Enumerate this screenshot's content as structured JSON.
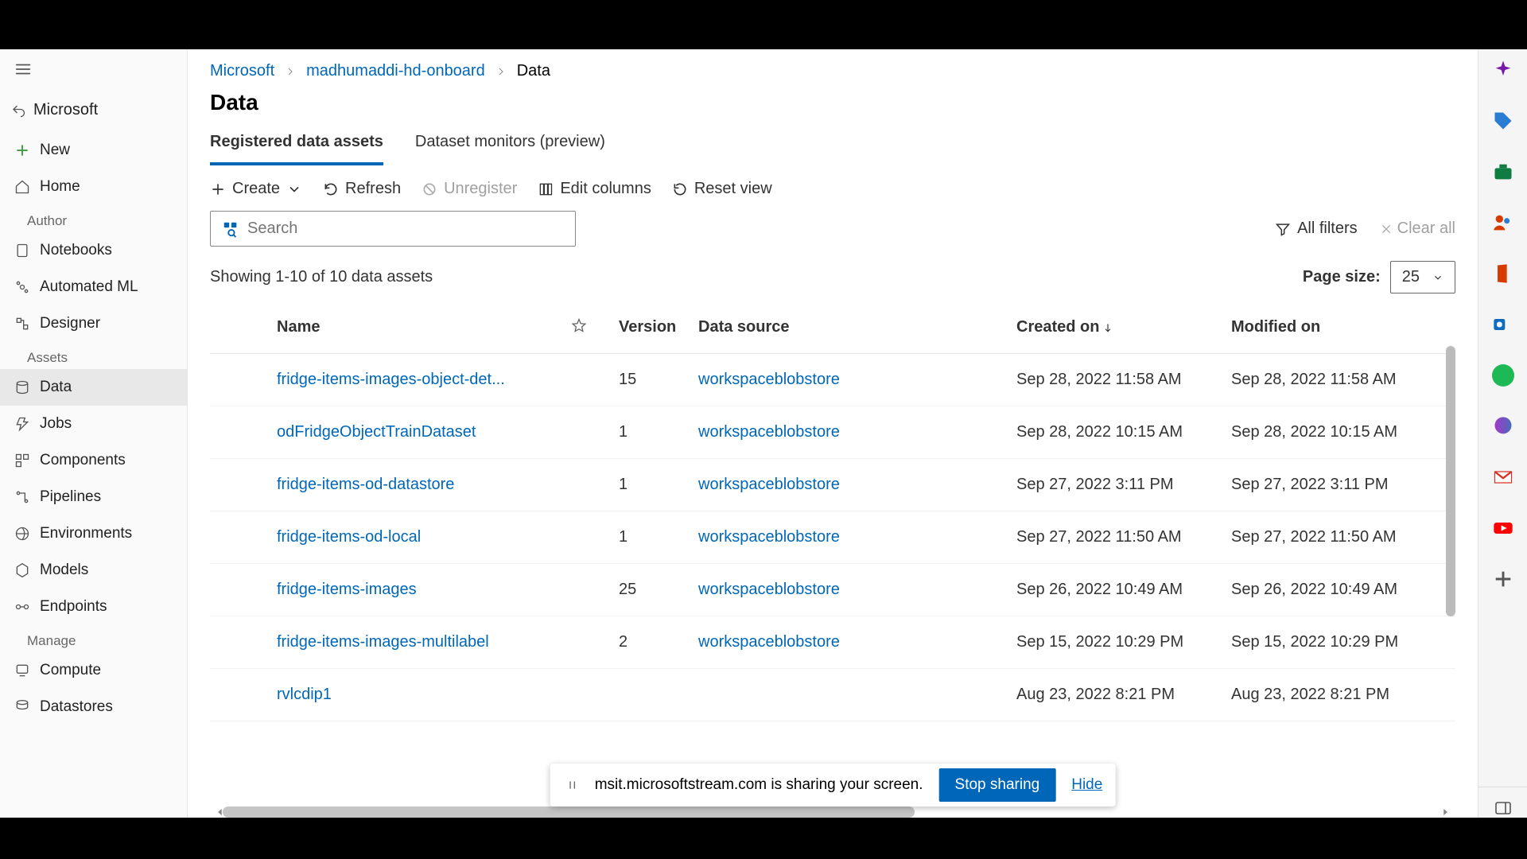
{
  "app_back": "Microsoft",
  "sidebar": {
    "new": "New",
    "home": "Home",
    "section_author": "Author",
    "author": [
      "Notebooks",
      "Automated ML",
      "Designer"
    ],
    "section_assets": "Assets",
    "assets": [
      "Data",
      "Jobs",
      "Components",
      "Pipelines",
      "Environments",
      "Models",
      "Endpoints"
    ],
    "section_manage": "Manage",
    "manage": [
      "Compute",
      "Datastores"
    ]
  },
  "breadcrumb": [
    "Microsoft",
    "madhumaddi-hd-onboard",
    "Data"
  ],
  "page_title": "Data",
  "tabs": [
    "Registered data assets",
    "Dataset monitors (preview)"
  ],
  "toolbar": {
    "create": "Create",
    "refresh": "Refresh",
    "unregister": "Unregister",
    "edit": "Edit columns",
    "reset": "Reset view"
  },
  "search_placeholder": "Search",
  "filters": {
    "all": "All filters",
    "clear": "Clear all"
  },
  "result_count": "Showing 1-10 of 10 data assets",
  "page_size_label": "Page size:",
  "page_size_value": "25",
  "columns": [
    "",
    "Name",
    "",
    "Version",
    "Data source",
    "Created on",
    "Modified on"
  ],
  "rows": [
    {
      "name": "fridge-items-images-object-det...",
      "version": "15",
      "ds": "workspaceblobstore",
      "created": "Sep 28, 2022 11:58 AM",
      "modified": "Sep 28, 2022 11:58 AM"
    },
    {
      "name": "odFridgeObjectTrainDataset",
      "version": "1",
      "ds": "workspaceblobstore",
      "created": "Sep 28, 2022 10:15 AM",
      "modified": "Sep 28, 2022 10:15 AM"
    },
    {
      "name": "fridge-items-od-datastore",
      "version": "1",
      "ds": "workspaceblobstore",
      "created": "Sep 27, 2022 3:11 PM",
      "modified": "Sep 27, 2022 3:11 PM"
    },
    {
      "name": "fridge-items-od-local",
      "version": "1",
      "ds": "workspaceblobstore",
      "created": "Sep 27, 2022 11:50 AM",
      "modified": "Sep 27, 2022 11:50 AM"
    },
    {
      "name": "fridge-items-images",
      "version": "25",
      "ds": "workspaceblobstore",
      "created": "Sep 26, 2022 10:49 AM",
      "modified": "Sep 26, 2022 10:49 AM"
    },
    {
      "name": "fridge-items-images-multilabel",
      "version": "2",
      "ds": "workspaceblobstore",
      "created": "Sep 15, 2022 10:29 PM",
      "modified": "Sep 15, 2022 10:29 PM"
    },
    {
      "name": "rvlcdip1",
      "version": "",
      "ds": "",
      "created": "Aug 23, 2022 8:21 PM",
      "modified": "Aug 23, 2022 8:21 PM"
    }
  ],
  "share": {
    "msg": "msit.microsoftstream.com is sharing your screen.",
    "stop": "Stop sharing",
    "hide": "Hide"
  }
}
